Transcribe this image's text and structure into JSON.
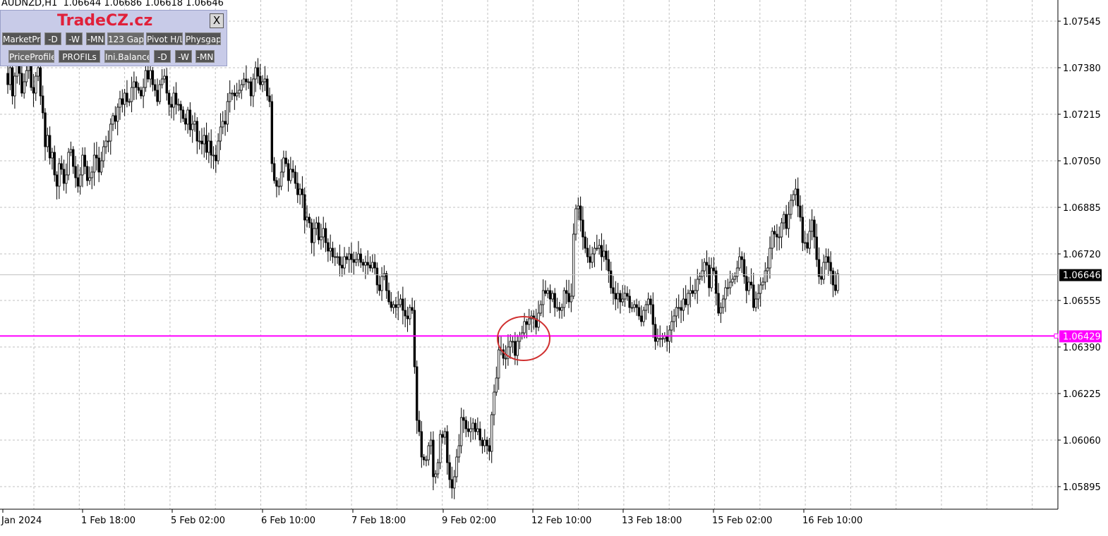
{
  "symbol_header": "AUDNZD,H1  1.06644 1.06686 1.06618 1.06646",
  "panel": {
    "brand": "TradeCZ.cz",
    "close_label": "X",
    "row1": [
      "MarketPr.",
      "-D",
      "-W",
      "-MN",
      "123 Gap",
      "Pivot H/L",
      "Physgap"
    ],
    "row2": [
      "PriceProfile",
      "PROFILs",
      "Ini.Balance",
      "-D",
      "-W",
      "-MN"
    ]
  },
  "colors": {
    "background": "#ffffff",
    "grid": "#c0c0c0",
    "candle": "#000000",
    "hline": "#ff00ff",
    "circle": "#d03030",
    "current_price_line": "#c0c0c0"
  },
  "chart_data": {
    "type": "candlestick",
    "symbol": "AUDNZD",
    "timeframe": "H1",
    "y_ticks": [
      "1.07545",
      "1.07380",
      "1.07215",
      "1.07050",
      "1.06885",
      "1.06720",
      "1.06555",
      "1.06390",
      "1.06225",
      "1.06060",
      "1.05895"
    ],
    "x_ticks": [
      "Jan 2024",
      "1 Feb 18:00",
      "5 Feb 02:00",
      "6 Feb 10:00",
      "7 Feb 18:00",
      "9 Feb 02:00",
      "12 Feb 10:00",
      "13 Feb 18:00",
      "15 Feb 02:00",
      "16 Feb 10:00"
    ],
    "ylim": [
      1.0578,
      1.076
    ],
    "current_price": "1.06646",
    "horizontal_line": "1.06429",
    "series": [
      {
        "close": [
          1.0732,
          1.0738,
          1.0728,
          1.0735,
          1.0741,
          1.0736,
          1.0729,
          1.0733,
          1.0737,
          1.0739,
          1.0731,
          1.0729,
          1.0735,
          1.0738,
          1.0728,
          1.0722,
          1.071,
          1.0714,
          1.0706,
          1.0708,
          1.07,
          1.0696,
          1.0704,
          1.0702,
          1.0697,
          1.07,
          1.0708,
          1.0709,
          1.0703,
          1.0699,
          1.0696,
          1.07,
          1.0707,
          1.0703,
          1.0698,
          1.0699,
          1.0701,
          1.0707,
          1.0706,
          1.0701,
          1.0705,
          1.071,
          1.0712,
          1.0712,
          1.0718,
          1.0721,
          1.0719,
          1.0724,
          1.0727,
          1.0725,
          1.0729,
          1.0726,
          1.0726,
          1.0731,
          1.0733,
          1.0731,
          1.073,
          1.0728,
          1.0731,
          1.0737,
          1.0734,
          1.0737,
          1.0732,
          1.073,
          1.0726,
          1.0732,
          1.0734,
          1.0735,
          1.0729,
          1.0725,
          1.0724,
          1.0729,
          1.0725,
          1.0725,
          1.0723,
          1.072,
          1.0718,
          1.0723,
          1.0716,
          1.0718,
          1.0719,
          1.0712,
          1.0712,
          1.0711,
          1.0714,
          1.0708,
          1.0712,
          1.0707,
          1.0707,
          1.0705,
          1.0712,
          1.0717,
          1.0719,
          1.0718,
          1.0726,
          1.0729,
          1.0729,
          1.0728,
          1.0729,
          1.073,
          1.0732,
          1.0734,
          1.0733,
          1.0733,
          1.0728,
          1.0734,
          1.0738,
          1.0735,
          1.0732,
          1.0733,
          1.0734,
          1.0728,
          1.0726,
          1.0704,
          1.0698,
          1.0696,
          1.0696,
          1.0701,
          1.0706,
          1.0704,
          1.0698,
          1.0702,
          1.0701,
          1.0697,
          1.0693,
          1.0695,
          1.0693,
          1.0684,
          1.0685,
          1.0683,
          1.0676,
          1.0681,
          1.0683,
          1.0677,
          1.0678,
          1.0681,
          1.0676,
          1.0673,
          1.0674,
          1.0671,
          1.0671,
          1.0671,
          1.0668,
          1.0667,
          1.0671,
          1.067,
          1.0672,
          1.067,
          1.0669,
          1.067,
          1.0672,
          1.0669,
          1.0668,
          1.0669,
          1.0668,
          1.0667,
          1.0669,
          1.0667,
          1.0661,
          1.0659,
          1.0664,
          1.0665,
          1.0659,
          1.0655,
          1.0653,
          1.0654,
          1.0653,
          1.0654,
          1.0656,
          1.0652,
          1.065,
          1.0649,
          1.0653,
          1.0652,
          1.0632,
          1.0613,
          1.0609,
          1.06,
          1.0599,
          1.0599,
          1.0604,
          1.0606,
          1.0593,
          1.0594,
          1.0598,
          1.0608,
          1.0607,
          1.0609,
          1.0598,
          1.0592,
          1.0589,
          1.0593,
          1.06,
          1.0604,
          1.0614,
          1.0613,
          1.061,
          1.0609,
          1.061,
          1.0612,
          1.0609,
          1.061,
          1.0606,
          1.0604,
          1.0606,
          1.0604,
          1.0602,
          1.0615,
          1.0623,
          1.0628,
          1.0638,
          1.0638,
          1.0635,
          1.0635,
          1.0639,
          1.0641,
          1.0641,
          1.0636,
          1.0641,
          1.0643,
          1.0644,
          1.0648,
          1.0647,
          1.0649,
          1.065,
          1.0649,
          1.0646,
          1.0651,
          1.0654,
          1.0659,
          1.0658,
          1.0659,
          1.0656,
          1.0658,
          1.0653,
          1.0653,
          1.0652,
          1.0653,
          1.0659,
          1.0658,
          1.0655,
          1.0657,
          1.0679,
          1.0688,
          1.0689,
          1.0684,
          1.0678,
          1.0674,
          1.0671,
          1.0669,
          1.0672,
          1.0674,
          1.0674,
          1.0675,
          1.0671,
          1.0673,
          1.067,
          1.0666,
          1.066,
          1.0658,
          1.0656,
          1.0658,
          1.0655,
          1.0656,
          1.0658,
          1.0657,
          1.0653,
          1.0653,
          1.0654,
          1.0653,
          1.065,
          1.0648,
          1.0652,
          1.0654,
          1.0656,
          1.0654,
          1.0647,
          1.0641,
          1.0642,
          1.0642,
          1.0642,
          1.0643,
          1.0641,
          1.0645,
          1.0648,
          1.065,
          1.0653,
          1.0653,
          1.0652,
          1.0656,
          1.0654,
          1.0658,
          1.0659,
          1.0658,
          1.0659,
          1.0663,
          1.0664,
          1.0666,
          1.0669,
          1.0668,
          1.066,
          1.0667,
          1.0666,
          1.0658,
          1.0651,
          1.0653,
          1.0656,
          1.066,
          1.066,
          1.0662,
          1.0663,
          1.0664,
          1.0667,
          1.0671,
          1.067,
          1.0664,
          1.0659,
          1.0662,
          1.0661,
          1.0653,
          1.0656,
          1.0658,
          1.0661,
          1.0662,
          1.0666,
          1.0667,
          1.0674,
          1.068,
          1.0679,
          1.0678,
          1.0678,
          1.0683,
          1.0686,
          1.0681,
          1.0686,
          1.0691,
          1.0693,
          1.0695,
          1.0689,
          1.0685,
          1.0676,
          1.0676,
          1.0674,
          1.068,
          1.0684,
          1.0678,
          1.067,
          1.0664,
          1.0663,
          1.0669,
          1.0671,
          1.0669,
          1.0666,
          1.0661,
          1.0659,
          1.0665
        ]
      }
    ]
  }
}
